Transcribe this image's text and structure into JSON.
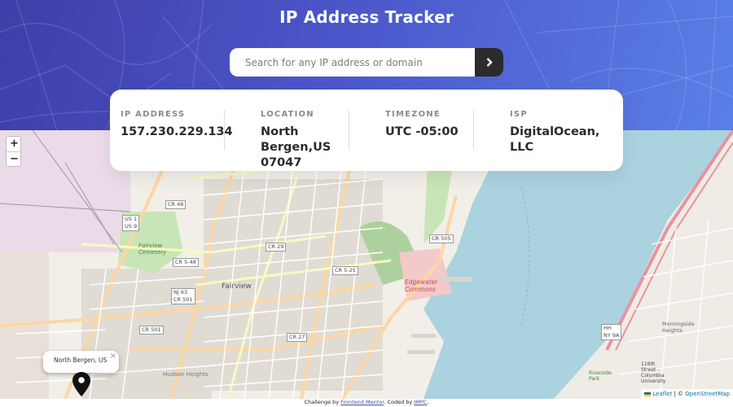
{
  "header": {
    "title": "IP Address Tracker",
    "background_gradient": [
      "#3f3ea8",
      "#5a7fe6"
    ]
  },
  "search": {
    "placeholder": "Search for any IP address or domain",
    "value": "",
    "submit_icon": "chevron-right-icon"
  },
  "info": {
    "ip_label": "IP ADDRESS",
    "ip_value": "157.230.229.134",
    "location_label": "LOCATION",
    "location_value": "North\nBergen,US\n07047",
    "timezone_label": "TIMEZONE",
    "timezone_value": "UTC -05:00",
    "isp_label": "ISP",
    "isp_value": "DigitalOcean,\nLLC"
  },
  "map": {
    "zoom_in": "+",
    "zoom_out": "−",
    "popup_text": "North Bergen, US",
    "popup_close": "×",
    "marker_icon": "location-pin-icon",
    "places": {
      "fairview": "Fairview",
      "fairview_cemetery": "Fairview\nCemetery",
      "edgewater_commons": "Edgewater\nCommons",
      "morningside_heights": "Morningside\nHeights",
      "columbia": "116th\nStreet -\nColumbia\nUniversity",
      "riverside_park": "Riverside\nPark",
      "hudson_heights": "Hudson Heights"
    },
    "roads": {
      "cr48": "CR 48",
      "us1": "US 1\nUS 9",
      "cr29": "CR 29",
      "cr548": "CR 5-48",
      "nj63": "NJ 63\nCR 501",
      "cr501": "CR 501",
      "cr27": "CR 27",
      "cr525": "CR 5-25",
      "cr505": "CR 505",
      "hh": "HH\nNY 9A"
    },
    "attribution": {
      "leaflet": "Leaflet",
      "separator": "| ©",
      "osm": "OpenStreetMap"
    }
  },
  "footer": {
    "prefix": "Challenge by",
    "mentor": "Frontend Mentor",
    "middle": ". Coded by",
    "author": "IMPC",
    "suffix": "."
  },
  "colors": {
    "text_dark": "#2b2b2b",
    "label_gray": "#8b8b8b",
    "water": "#aad3df",
    "park": "#c8e6b5"
  }
}
